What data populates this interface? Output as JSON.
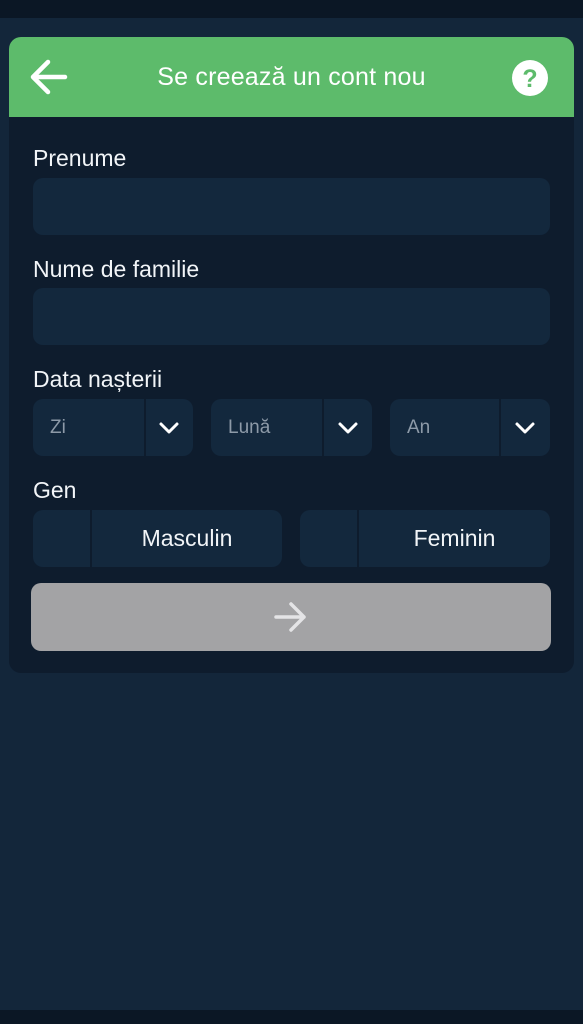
{
  "header": {
    "title": "Se creează un cont nou",
    "back_icon": "arrow-left-icon",
    "help_icon": "question-circle-icon",
    "accent_color": "#5dbb6b"
  },
  "form": {
    "first_name": {
      "label": "Prenume",
      "value": ""
    },
    "last_name": {
      "label": "Nume de familie",
      "value": ""
    },
    "birth_date": {
      "label": "Data nașterii",
      "day_placeholder": "Zi",
      "month_placeholder": "Lună",
      "year_placeholder": "An",
      "dropdown_icon": "chevron-down-icon"
    },
    "gender": {
      "label": "Gen",
      "options": [
        {
          "label": "Masculin",
          "selected": false
        },
        {
          "label": "Feminin",
          "selected": false
        }
      ]
    },
    "submit": {
      "icon": "arrow-right-icon",
      "enabled": false,
      "disabled_color": "#a3a3a5"
    }
  },
  "colors": {
    "background": "#13263a",
    "card": "#0e1c2d",
    "field": "#13283d"
  }
}
